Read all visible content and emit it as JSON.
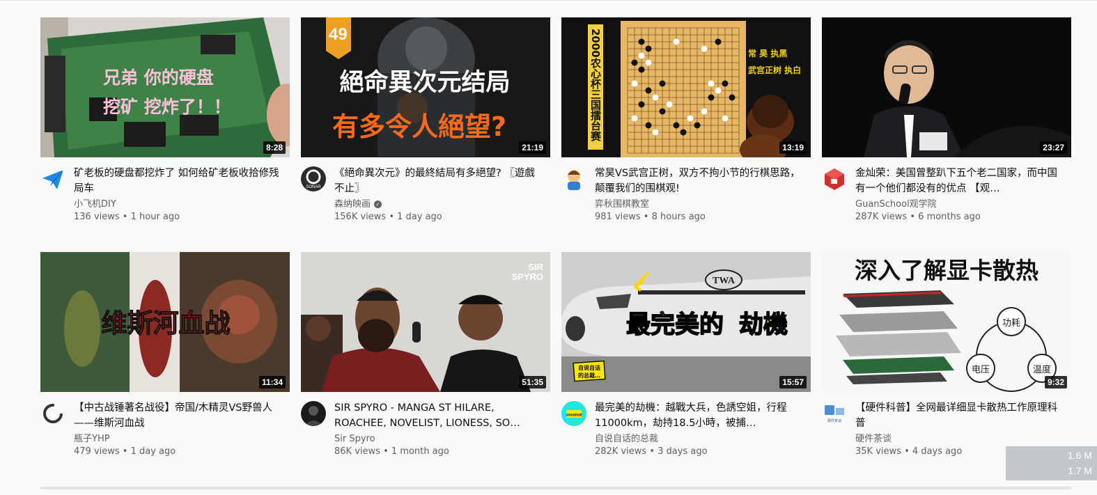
{
  "videos": [
    {
      "thumb_text": [
        "兄弟 你的硬盘",
        "挖矿 挖炸了！！"
      ],
      "duration": "8:28",
      "title": "矿老板的硬盘都挖炸了 如何给矿老板收拾修残局车",
      "channel": "小飞机DIY",
      "verified": false,
      "views": "136 views",
      "age": "1 hour ago"
    },
    {
      "thumb_text": [
        "49",
        "絕命異次元结局",
        "有多令人絕望?"
      ],
      "avatar_text": "SONAR",
      "duration": "21:19",
      "title": "《絕命異次元》的最終結局有多絕望? 〖遊戲不止〗",
      "channel": "森纳映画",
      "verified": true,
      "views": "156K views",
      "age": "1 day ago"
    },
    {
      "thumb_text": [
        "2000农心杯三国擂台赛",
        "常 昊 执黑",
        "武宫正树 执白"
      ],
      "duration": "13:19",
      "title": "常昊VS武宫正树，双方不拘小节的行棋思路，颠覆我们的围棋观!",
      "channel": "弈秋围棋教室",
      "verified": false,
      "views": "981 views",
      "age": "8 hours ago"
    },
    {
      "thumb_text": [],
      "duration": "23:27",
      "title": "金灿荣：美国曾整趴下五个老二国家，而中国有一个他们都没有的优点 【观…",
      "channel": "GuanSchool观学院",
      "verified": false,
      "views": "287K views",
      "age": "6 months ago"
    },
    {
      "thumb_text": [
        "维斯河血战"
      ],
      "duration": "11:34",
      "title": "【中古战锤著名战役】帝国/木精灵VS野兽人——维斯河血战",
      "channel": "瓶子YHP",
      "verified": false,
      "views": "479 views",
      "age": "1 day ago"
    },
    {
      "thumb_text": [
        "SIR",
        "SPYRO"
      ],
      "duration": "51:35",
      "title": "SIR SPYRO - MANGA ST HILARE, ROACHEE, NOVELIST, LIONESS, SO…",
      "channel": "Sir Spyro",
      "verified": false,
      "views": "86K views",
      "age": "1 month ago"
    },
    {
      "thumb_text": [
        "最完美的",
        "劫機",
        "TWA",
        "自说自话",
        "的总裁…"
      ],
      "avatar_text": "自说自话的总裁",
      "duration": "15:57",
      "title": "最完美的劫機：越戰大兵，色誘空姐，行程11000km，劫持18.5小時，被捕…",
      "channel": "自说自话的总裁",
      "verified": false,
      "views": "282K views",
      "age": "3 days ago"
    },
    {
      "thumb_text": [
        "深入了解显卡散热",
        "功耗",
        "电压",
        "温度"
      ],
      "avatar_text": "硬件茶谈",
      "duration": "9:32",
      "title": "【硬件科普】全网最详细显卡散热工作原理科普",
      "channel": "硬件茶谈",
      "verified": false,
      "views": "35K views",
      "age": "4 days ago"
    }
  ],
  "separator": "•",
  "popup": {
    "line1": "1.6 M",
    "line2": "1.7 M"
  }
}
